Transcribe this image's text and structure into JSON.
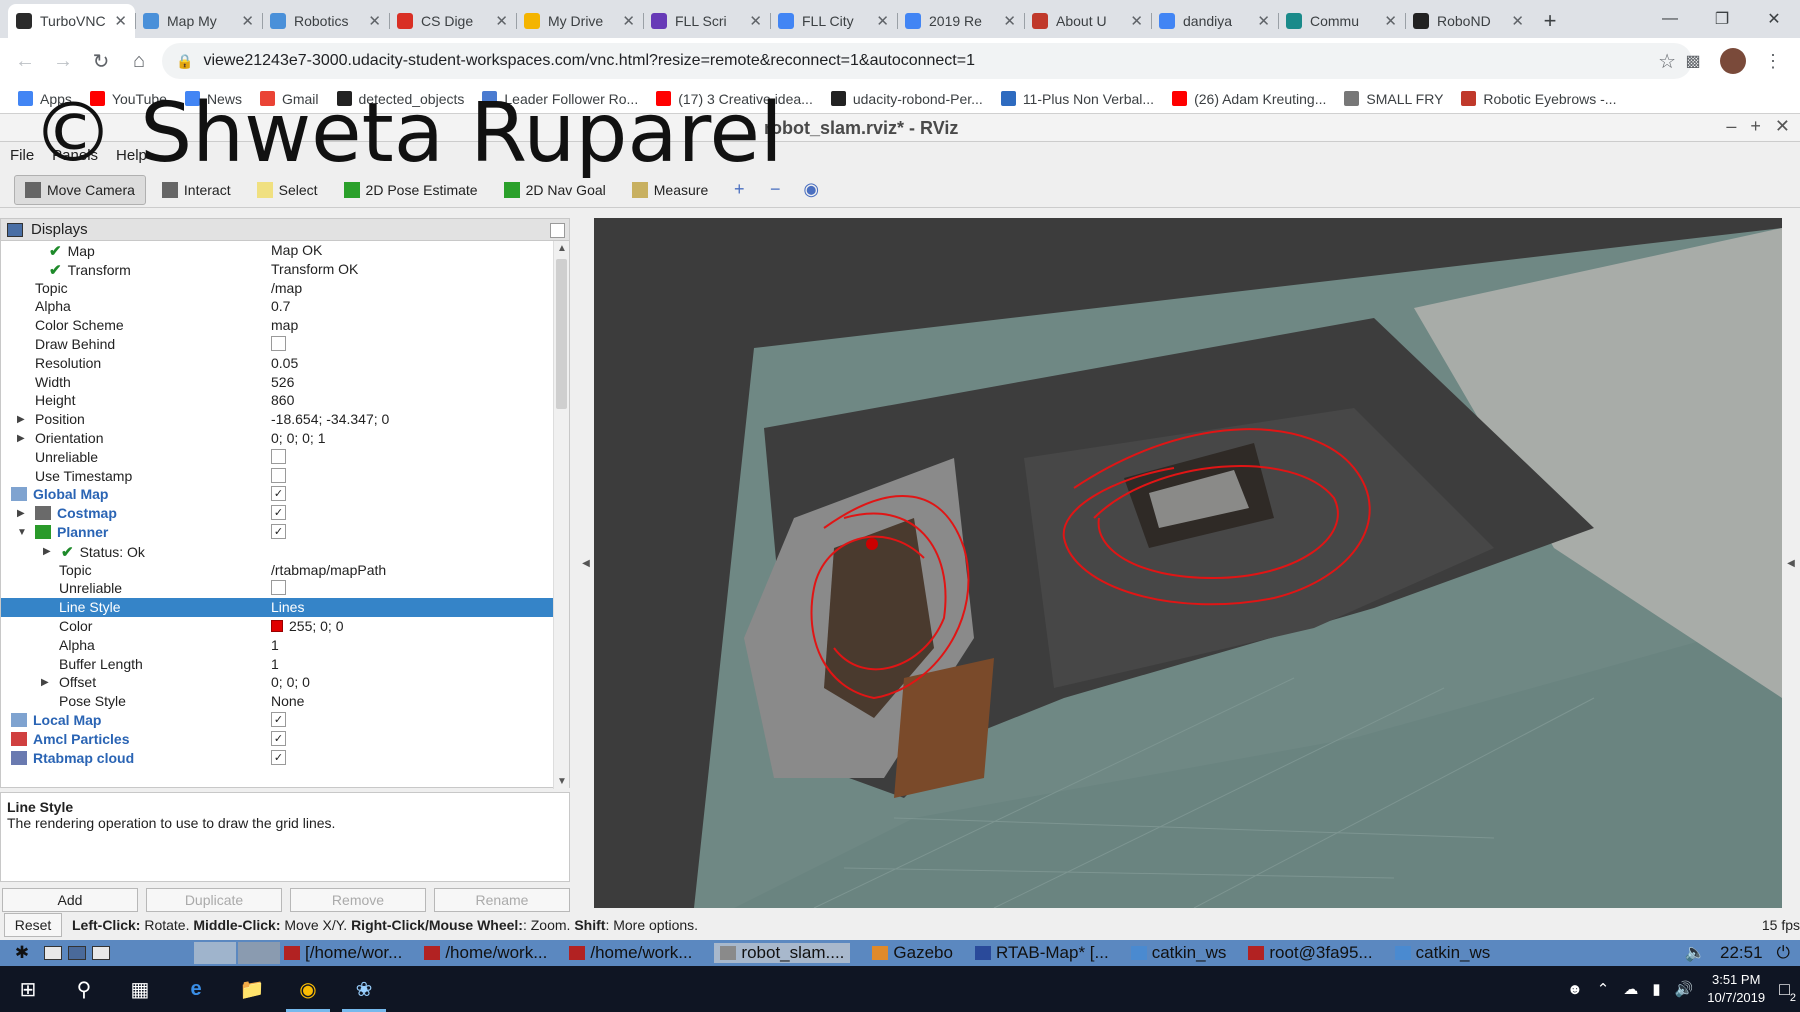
{
  "browser": {
    "tabs": [
      {
        "title": "TurboVNC",
        "color": "#2b2b2b",
        "active": true
      },
      {
        "title": "Map My",
        "color": "#4a90d9"
      },
      {
        "title": "Robotics",
        "color": "#4a90d9"
      },
      {
        "title": "CS Dige",
        "color": "#d93025"
      },
      {
        "title": "My Drive",
        "color": "#f4b400"
      },
      {
        "title": "FLL Scri",
        "color": "#673ab7"
      },
      {
        "title": "FLL City",
        "color": "#4285f4"
      },
      {
        "title": "2019 Re",
        "color": "#4285f4"
      },
      {
        "title": "About U",
        "color": "#c0392b"
      },
      {
        "title": "dandiya",
        "color": "#4285f4"
      },
      {
        "title": "Commu",
        "color": "#1a8a8a"
      },
      {
        "title": "RoboND",
        "color": "#222222"
      }
    ],
    "url": "viewe21243e7-3000.udacity-student-workspaces.com/vnc.html?resize=remote&reconnect=1&autoconnect=1",
    "bookmarks": [
      {
        "label": "Apps",
        "color": "#4285f4"
      },
      {
        "label": "YouTube",
        "color": "#ff0000"
      },
      {
        "label": "News",
        "color": "#4285f4"
      },
      {
        "label": "Gmail",
        "color": "#ea4335"
      },
      {
        "label": "detected_objects",
        "color": "#222222"
      },
      {
        "label": "Leader Follower Ro...",
        "color": "#4a7bd0"
      },
      {
        "label": "(17) 3 Creative idea...",
        "color": "#ff0000"
      },
      {
        "label": "udacity-robond-Per...",
        "color": "#222222"
      },
      {
        "label": "11-Plus Non Verbal...",
        "color": "#2e6bc0"
      },
      {
        "label": "(26) Adam Kreuting...",
        "color": "#ff0000"
      },
      {
        "label": "SMALL FRY",
        "color": "#777777"
      },
      {
        "label": "Robotic Eyebrows -...",
        "color": "#c0392b"
      }
    ]
  },
  "watermark": "© Shweta Ruparel",
  "rviz": {
    "title": "robot_slam.rviz* - RViz",
    "menu": [
      "File",
      "Panels",
      "Help"
    ],
    "tools": [
      {
        "label": "Move Camera",
        "pressed": true,
        "color": "#666666"
      },
      {
        "label": "Interact",
        "color": "#666666"
      },
      {
        "label": "Select",
        "color": "#f0e080"
      },
      {
        "label": "2D Pose Estimate",
        "color": "#2aa02a"
      },
      {
        "label": "2D Nav Goal",
        "color": "#2aa02a"
      },
      {
        "label": "Measure",
        "color": "#c8b060"
      }
    ],
    "displays_title": "Displays",
    "rows": [
      {
        "key": "Map",
        "value": "Map OK",
        "indent": 72,
        "tick": true
      },
      {
        "key": "Transform",
        "value": "Transform OK",
        "indent": 72,
        "tick": true
      },
      {
        "key": "Topic",
        "value": "/map",
        "indent": 34
      },
      {
        "key": "Alpha",
        "value": "0.7",
        "indent": 34
      },
      {
        "key": "Color Scheme",
        "value": "map",
        "indent": 34
      },
      {
        "key": "Draw Behind",
        "check": false,
        "indent": 34
      },
      {
        "key": "Resolution",
        "value": "0.05",
        "indent": 34
      },
      {
        "key": "Width",
        "value": "526",
        "indent": 34
      },
      {
        "key": "Height",
        "value": "860",
        "indent": 34
      },
      {
        "key": "Position",
        "value": "-18.654; -34.347; 0",
        "indent": 34,
        "expand": "closed"
      },
      {
        "key": "Orientation",
        "value": "0; 0; 0; 1",
        "indent": 34,
        "expand": "closed"
      },
      {
        "key": "Unreliable",
        "check": false,
        "indent": 34
      },
      {
        "key": "Use Timestamp",
        "check": false,
        "indent": 34
      },
      {
        "key": "Global Map",
        "check": true,
        "indent": 36,
        "cat": true,
        "icon": "folder"
      },
      {
        "key": "Costmap",
        "check": true,
        "indent": 60,
        "cat": true,
        "icon": "grid",
        "expand": "closed"
      },
      {
        "key": "Planner",
        "check": true,
        "indent": 60,
        "cat": true,
        "icon": "path",
        "expand": "open"
      },
      {
        "key": "Status: Ok",
        "indent": 84,
        "tick": true,
        "expand": "closed"
      },
      {
        "key": "Topic",
        "value": "/rtabmap/mapPath",
        "indent": 58
      },
      {
        "key": "Unreliable",
        "check": false,
        "indent": 58
      },
      {
        "key": "Line Style",
        "value": "Lines",
        "indent": 58,
        "selected": true
      },
      {
        "key": "Color",
        "value": "255; 0; 0",
        "indent": 58,
        "swatch": "#e00000"
      },
      {
        "key": "Alpha",
        "value": "1",
        "indent": 58
      },
      {
        "key": "Buffer Length",
        "value": "1",
        "indent": 58
      },
      {
        "key": "Offset",
        "value": "0; 0; 0",
        "indent": 58,
        "expand": "closed"
      },
      {
        "key": "Pose Style",
        "value": "None",
        "indent": 58
      },
      {
        "key": "Local Map",
        "check": true,
        "indent": 36,
        "cat": true,
        "icon": "folder"
      },
      {
        "key": "Amcl Particles",
        "check": true,
        "indent": 36,
        "cat": true,
        "icon": "particles"
      },
      {
        "key": "Rtabmap cloud",
        "check": true,
        "indent": 36,
        "cat": true,
        "icon": "cloud"
      }
    ],
    "description": {
      "title": "Line Style",
      "text": "The rendering operation to use to draw the grid lines."
    },
    "buttons": {
      "add": "Add",
      "duplicate": "Duplicate",
      "remove": "Remove",
      "rename": "Rename"
    },
    "status": {
      "reset": "Reset",
      "left_click": "Left-Click:",
      "left_action": " Rotate. ",
      "middle_click": "Middle-Click:",
      "middle_action": " Move X/Y. ",
      "right_click": "Right-Click/Mouse Wheel:",
      "right_action": ": Zoom. ",
      "shift": "Shift",
      "shift_action": ": More options.",
      "fps": "15 fps"
    }
  },
  "vnc_taskbar": {
    "tasks": [
      {
        "label": "[/home/wor...",
        "color": "#b22222"
      },
      {
        "label": "/home/work...",
        "color": "#b22222"
      },
      {
        "label": "/home/work...",
        "color": "#b22222"
      },
      {
        "label": "robot_slam....",
        "color": "#8a8a8a",
        "current": true
      },
      {
        "label": "Gazebo",
        "color": "#e08a2a"
      },
      {
        "label": "RTAB-Map* [...",
        "color": "#2a4a9a"
      },
      {
        "label": "catkin_ws",
        "color": "#4a8ad0"
      },
      {
        "label": "root@3fa95...",
        "color": "#b22222"
      },
      {
        "label": "catkin_ws",
        "color": "#4a8ad0"
      }
    ],
    "time": "22:51"
  },
  "windows": {
    "time": "3:51 PM",
    "date": "10/7/2019",
    "notifications": "2"
  }
}
